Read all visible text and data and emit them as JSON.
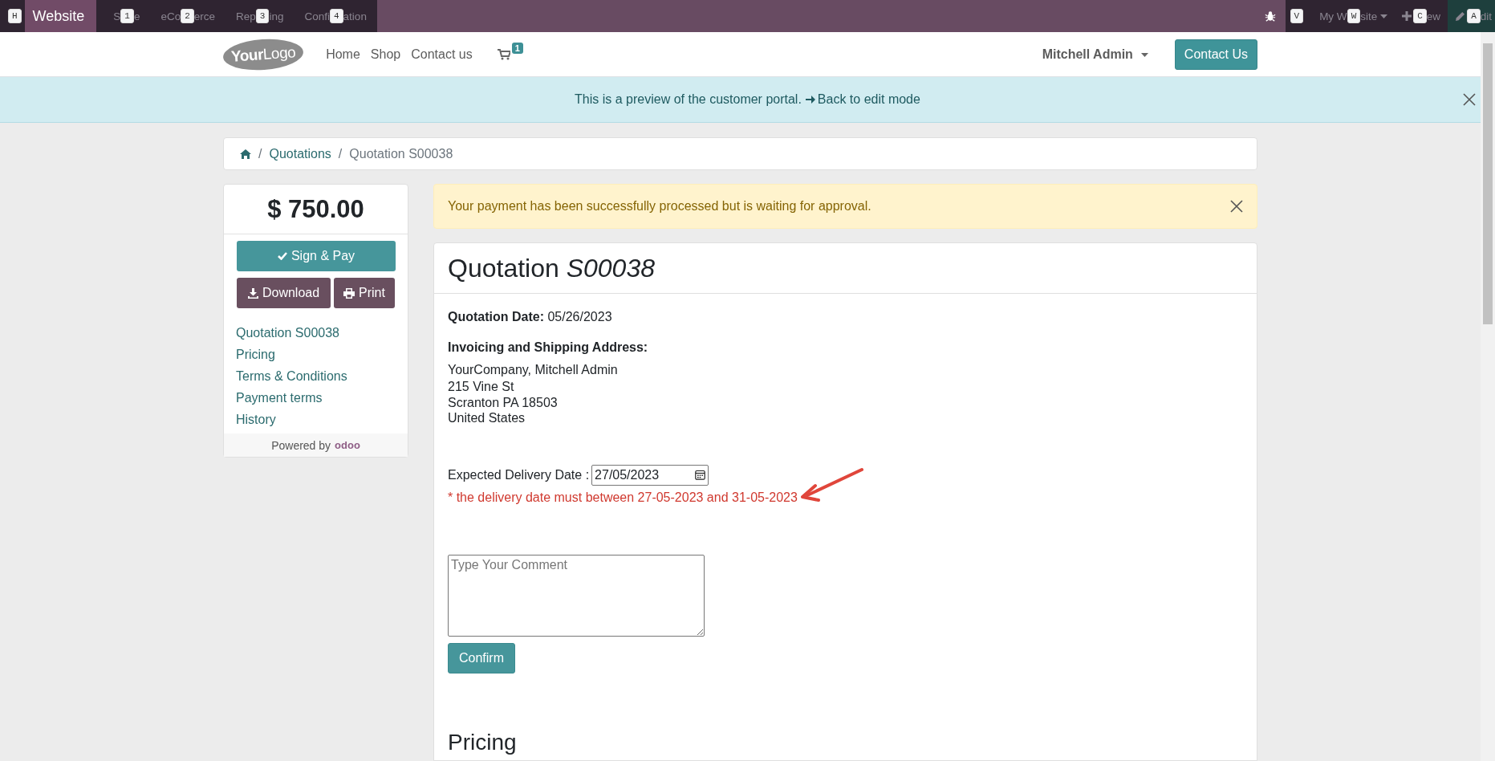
{
  "topbar": {
    "app": {
      "hotkey": "H",
      "name": "Website"
    },
    "menu": [
      {
        "hotkey": "1",
        "parts": [
          "S",
          "e"
        ]
      },
      {
        "hotkey": "2",
        "parts": [
          "eCo",
          "erce"
        ]
      },
      {
        "hotkey": "3",
        "parts": [
          "Rep",
          "ing"
        ]
      },
      {
        "hotkey": "4",
        "parts": [
          "Confi",
          "ation"
        ]
      }
    ],
    "systray": [
      {
        "kind": "debug",
        "hotkey": "V"
      },
      {
        "kind": "dropdown",
        "hotkey": "W",
        "parts": [
          "My W",
          "site"
        ]
      },
      {
        "kind": "new",
        "hotkey": "C",
        "parts": [
          "ew"
        ]
      },
      {
        "kind": "edit",
        "hotkey": "A",
        "parts": [
          "dit"
        ]
      }
    ]
  },
  "header": {
    "logo": "**Your**Logo",
    "nav": [
      "Home",
      "Shop",
      "Contact us"
    ],
    "cart_count": "1",
    "user": "Mitchell Admin",
    "cta": "Contact Us"
  },
  "preview_banner": {
    "text": "This is a preview of the customer portal.",
    "link": "Back to edit mode"
  },
  "breadcrumb": {
    "separator": "/",
    "items": [
      "Quotations",
      "Quotation S00038"
    ]
  },
  "sidebar": {
    "amount": "$ 750.00",
    "sign_button": "Sign & Pay",
    "download_button": "Download",
    "print_button": "Print",
    "links": [
      "Quotation S00038",
      "Pricing",
      "Terms & Conditions",
      "Payment terms",
      "History"
    ],
    "powered_by": "Powered by",
    "brand": "odoo"
  },
  "alert": "Your payment has been successfully processed but is waiting for approval.",
  "quotation": {
    "title": "Quotation *S00038*",
    "date_line": "**Quotation Date:** 05/26/2023",
    "address_label": "Invoicing and Shipping Address:",
    "address": [
      "YourCompany, Mitchell Admin",
      "215 Vine St",
      "Scranton PA 18503",
      "United States"
    ],
    "delivery_label": "Expected Delivery Date :",
    "delivery_value": "27/05/2023",
    "delivery_note": "* the delivery date must between 27-05-2023 and 31-05-2023",
    "comment": {
      "placeholder": "Type Your Comment"
    },
    "confirm_button": "Confirm",
    "next_section": "Pricing"
  }
}
